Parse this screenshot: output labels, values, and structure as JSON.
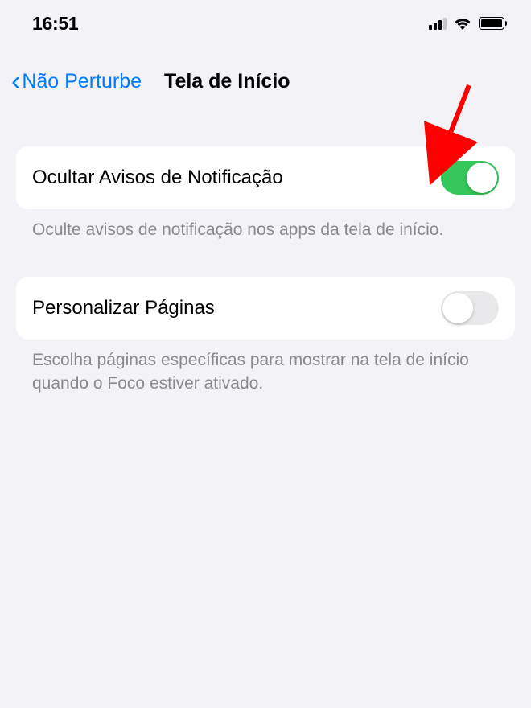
{
  "status": {
    "time": "16:51"
  },
  "nav": {
    "back_label": "Não Perturbe",
    "title": "Tela de Início"
  },
  "settings": {
    "hide_notifications": {
      "label": "Ocultar Avisos de Notificação",
      "footer": "Oculte avisos de notificação nos apps da tela de início.",
      "enabled": true
    },
    "customize_pages": {
      "label": "Personalizar Páginas",
      "footer": "Escolha páginas específicas para mostrar na tela de início quando o Foco estiver ativado.",
      "enabled": false
    }
  }
}
